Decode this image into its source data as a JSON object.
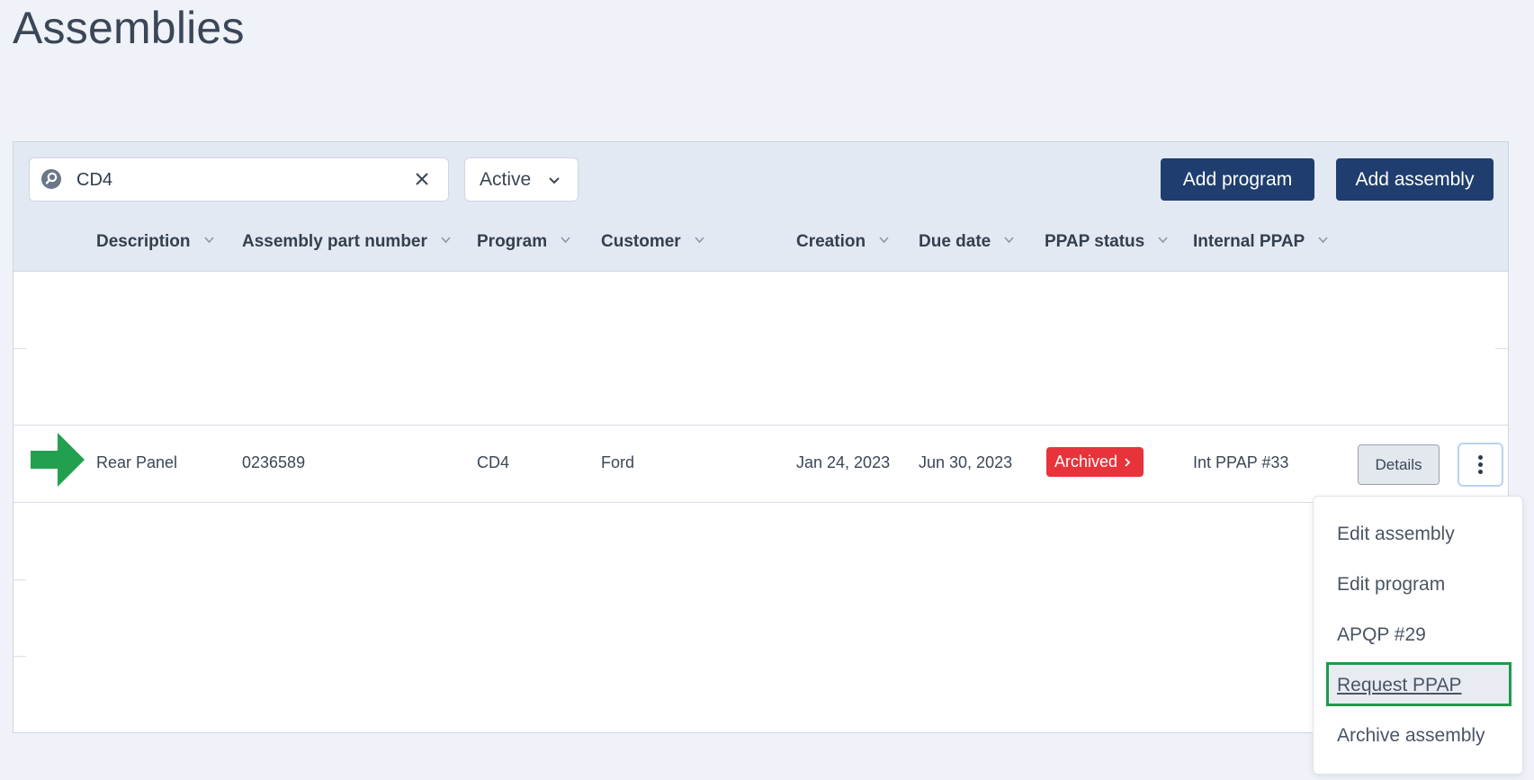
{
  "page": {
    "title": "Assemblies"
  },
  "toolbar": {
    "search_value": "CD4",
    "status_filter": "Active",
    "add_program_label": "Add program",
    "add_assembly_label": "Add assembly"
  },
  "columns": [
    "Description",
    "Assembly part number",
    "Program",
    "Customer",
    "Creation",
    "Due date",
    "PPAP status",
    "Internal PPAP"
  ],
  "row": {
    "description": "Rear Panel",
    "assembly_part_number": "0236589",
    "program": "CD4",
    "customer": "Ford",
    "creation": "Jan 24, 2023",
    "due_date": "Jun 30, 2023",
    "ppap_status": "Archived",
    "internal_ppap": "Int PPAP #33",
    "details_label": "Details"
  },
  "menu": {
    "items": [
      "Edit assembly",
      "Edit program",
      "APQP #29",
      "Request PPAP",
      "Archive assembly"
    ],
    "highlighted": "Request PPAP"
  },
  "colors": {
    "primary": "#1f3e6f",
    "archived_badge": "#e8333b",
    "highlight_border": "#1f9a4d",
    "arrow": "#22a04f"
  },
  "icons": {
    "search": "search-icon",
    "clear": "close-icon",
    "dropdown": "chevron-down-icon",
    "more": "kebab-icon",
    "arrow": "arrow-right-icon"
  }
}
